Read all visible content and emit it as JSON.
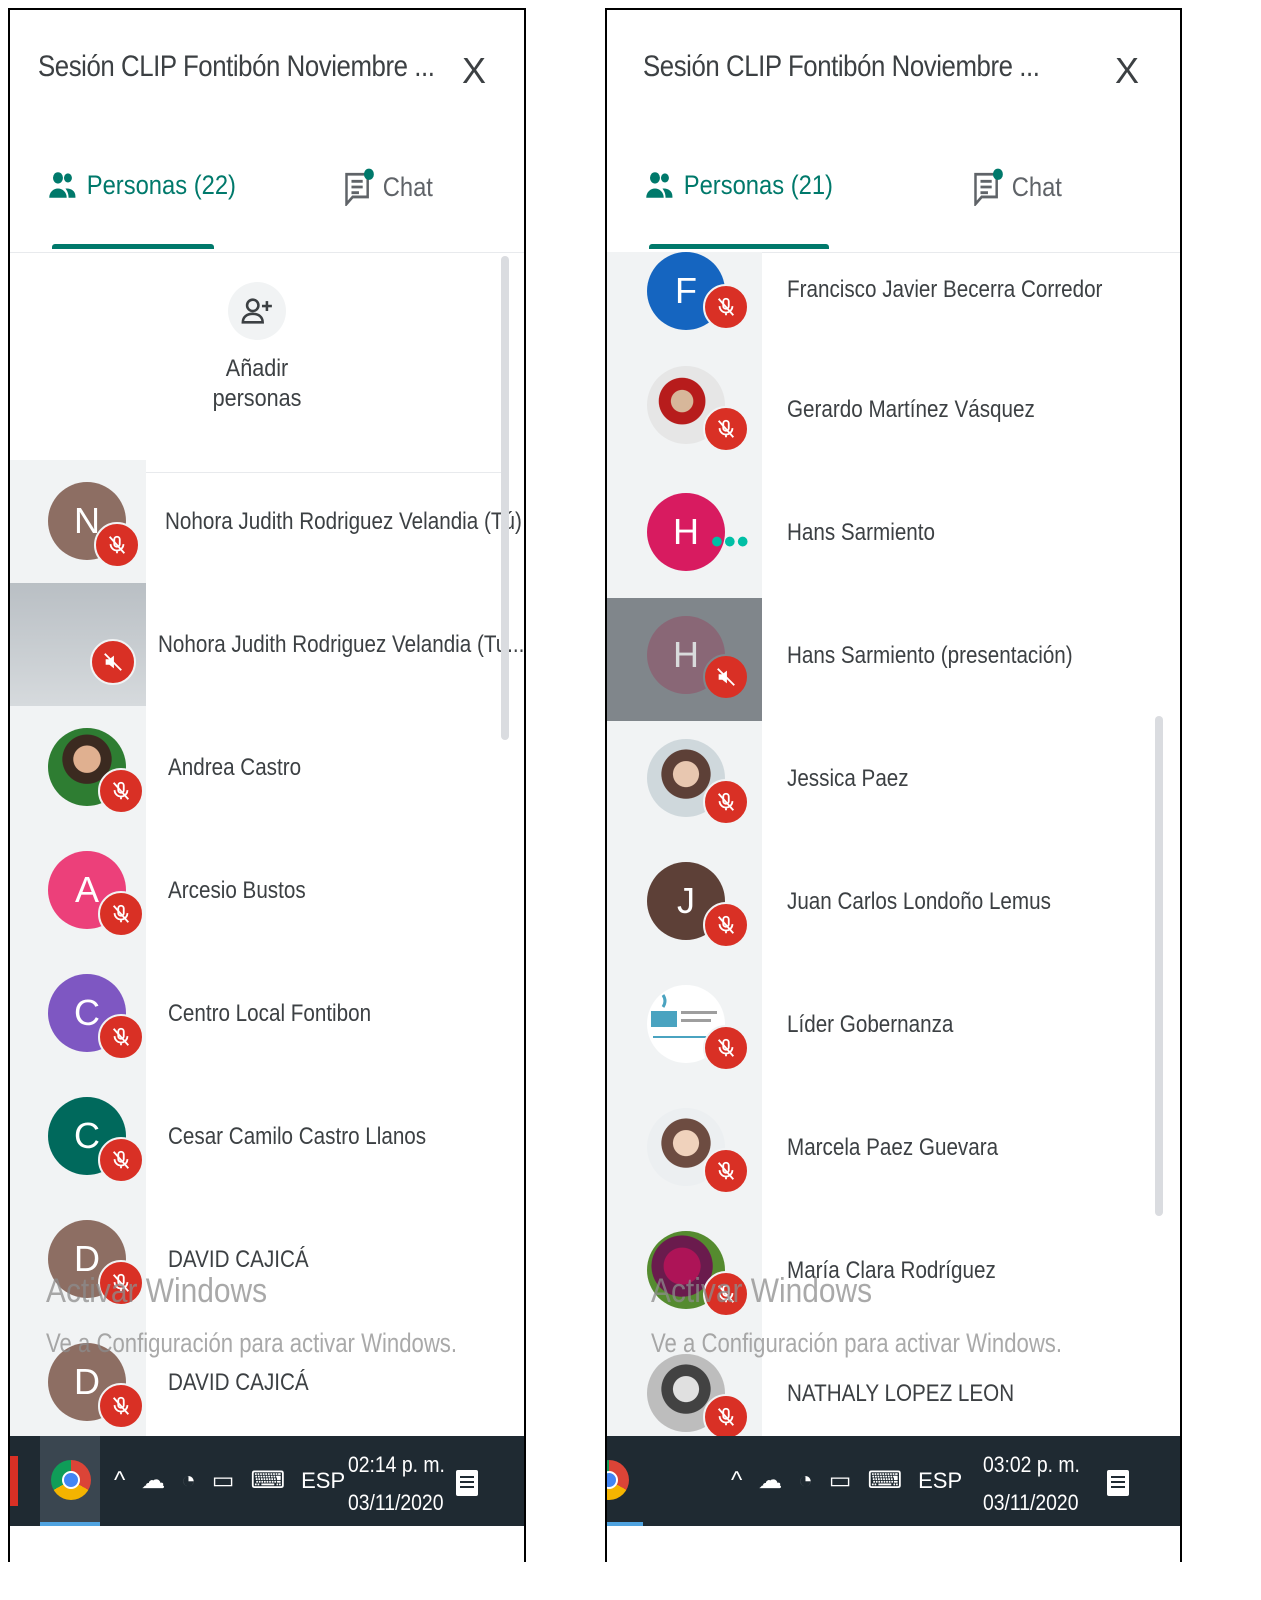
{
  "colors": {
    "accent": "#00796b",
    "mic_muted": "#d93025",
    "taskbar": "#1f2a32"
  },
  "left": {
    "title": "Sesión CLIP Fontibón Noviembre ...",
    "close_label": "X",
    "tab_people": "Personas (22)",
    "tab_chat": "Chat",
    "add_people_label_1": "Añadir",
    "add_people_label_2": "personas",
    "participants": [
      {
        "initial": "N",
        "name": "Nohora Judith Rodriguez Velandia (Tú)",
        "color": "#8d6e63"
      },
      {
        "initial": "",
        "name": "Nohora Judith Rodriguez Velandia (Tu...",
        "color": "#9e9e9e"
      },
      {
        "initial": "",
        "name": "Andrea Castro",
        "color": "#2e7d32"
      },
      {
        "initial": "A",
        "name": "Arcesio Bustos",
        "color": "#ec407a"
      },
      {
        "initial": "C",
        "name": "Centro Local Fontibon",
        "color": "#7e57c2"
      },
      {
        "initial": "C",
        "name": "Cesar Camilo Castro Llanos",
        "color": "#00695c"
      },
      {
        "initial": "D",
        "name": "DAVID CAJICÁ",
        "color": "#8d6e63"
      },
      {
        "initial": "D",
        "name": "DAVID CAJICÁ",
        "color": "#8d6e63"
      }
    ],
    "watermark_title": "Activar Windows",
    "watermark_sub": "Ve a Configuración para activar Windows.",
    "taskbar": {
      "lang": "ESP",
      "time": "02:14 p. m.",
      "date": "03/11/2020"
    }
  },
  "right": {
    "title": "Sesión CLIP Fontibón Noviembre ...",
    "close_label": "X",
    "tab_people": "Personas (21)",
    "tab_chat": "Chat",
    "participants": [
      {
        "initial": "F",
        "name": "Francisco Javier Becerra Corredor",
        "color": "#1565c0"
      },
      {
        "initial": "",
        "name": "Gerardo Martínez Vásquez",
        "color": "#b0a79a"
      },
      {
        "initial": "H",
        "name": "Hans Sarmiento",
        "color": "#d81b60"
      },
      {
        "initial": "H",
        "name": "Hans Sarmiento (presentación)",
        "color": "#8e5a6e"
      },
      {
        "initial": "",
        "name": "Jessica Paez",
        "color": "#a1887f"
      },
      {
        "initial": "J",
        "name": "Juan Carlos Londoño Lemus",
        "color": "#5d4037"
      },
      {
        "initial": "",
        "name": "Líder Gobernanza",
        "color": "#4aa3c0"
      },
      {
        "initial": "",
        "name": "Marcela Paez Guevara",
        "color": "#bcaaa4"
      },
      {
        "initial": "",
        "name": "María Clara Rodríguez",
        "color": "#ad1457"
      },
      {
        "initial": "",
        "name": "NATHALY LOPEZ LEON",
        "color": "#9e9e9e"
      }
    ],
    "speaking_indicator": "•••",
    "watermark_title": "Activar Windows",
    "watermark_sub": "Ve a Configuración para activar Windows.",
    "taskbar": {
      "lang": "ESP",
      "time": "03:02 p. m.",
      "date": "03/11/2020"
    }
  }
}
